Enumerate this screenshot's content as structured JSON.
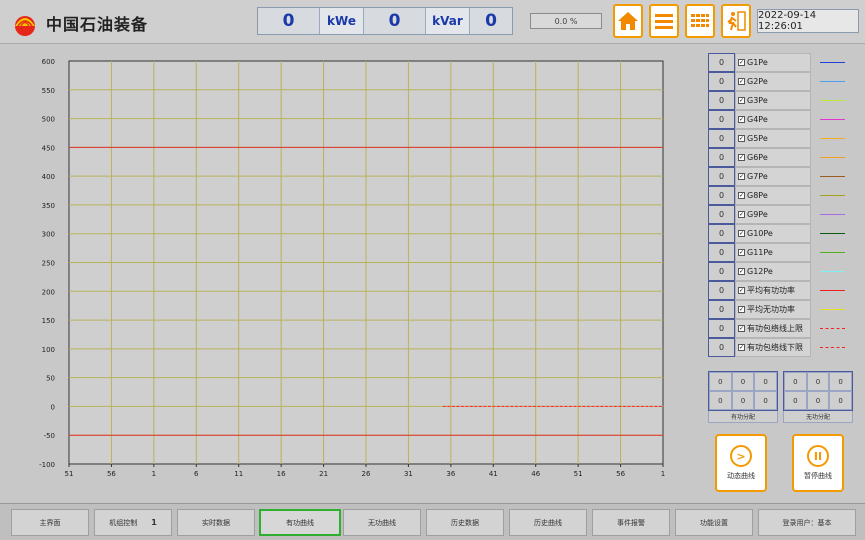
{
  "header": {
    "brand": "中国石油装备",
    "active_power_value": "0",
    "active_power_unit": "kWe",
    "reactive_power_value": "0",
    "reactive_power_unit": "kVar",
    "third_value": "0",
    "percent": "0.0 %",
    "datetime": "2022-09-14 12:26:01",
    "nav_icons": [
      "home-icon",
      "menu-icon",
      "grid-icon",
      "exit-icon"
    ]
  },
  "chart_data": {
    "type": "line",
    "y_ticks": [
      "600",
      "550",
      "500",
      "450",
      "400",
      "350",
      "300",
      "250",
      "200",
      "150",
      "100",
      "50",
      "0",
      "-50",
      "-100"
    ],
    "x_ticks": [
      "51",
      "56",
      "1",
      "6",
      "11",
      "16",
      "21",
      "26",
      "31",
      "36",
      "41",
      "46",
      "51",
      "56",
      "1"
    ],
    "ylim": [
      -100,
      600
    ],
    "grid": true,
    "upper_limit": 450,
    "lower_limit": -50,
    "series": [
      {
        "x_start_tick": 9,
        "x_end_tick": 14,
        "y": 0,
        "color": "#ff3030",
        "dashed": true
      }
    ],
    "colors": {
      "grid": "#b8b35a",
      "limit": "#e03030",
      "axis": "#333333"
    }
  },
  "legend": [
    {
      "value": "0",
      "label": "G1Pe",
      "color": "#1f3fd6",
      "dashed": false
    },
    {
      "value": "0",
      "label": "G2Pe",
      "color": "#4aa0f0",
      "dashed": false
    },
    {
      "value": "0",
      "label": "G3Pe",
      "color": "#b6ef3c",
      "dashed": false
    },
    {
      "value": "0",
      "label": "G4Pe",
      "color": "#e434d4",
      "dashed": false
    },
    {
      "value": "0",
      "label": "G5Pe",
      "color": "#f2b020",
      "dashed": false
    },
    {
      "value": "0",
      "label": "G6Pe",
      "color": "#f0a020",
      "dashed": false
    },
    {
      "value": "0",
      "label": "G7Pe",
      "color": "#9a5a20",
      "dashed": false
    },
    {
      "value": "0",
      "label": "G8Pe",
      "color": "#a79e20",
      "dashed": false
    },
    {
      "value": "0",
      "label": "G9Pe",
      "color": "#a46de0",
      "dashed": false
    },
    {
      "value": "0",
      "label": "G10Pe",
      "color": "#0b5a10",
      "dashed": false
    },
    {
      "value": "0",
      "label": "G11Pe",
      "color": "#54b020",
      "dashed": false
    },
    {
      "value": "0",
      "label": "G12Pe",
      "color": "#7ef0f0",
      "dashed": false
    },
    {
      "value": "0",
      "label": "平均有功功率",
      "color": "#ee2020",
      "dashed": false
    },
    {
      "value": "0",
      "label": "平均无功功率",
      "color": "#e8e020",
      "dashed": false
    },
    {
      "value": "0",
      "label": "有功包络线上限",
      "color": "#ee2020",
      "dashed": true
    },
    {
      "value": "0",
      "label": "有功包络线下限",
      "color": "#ee2020",
      "dashed": true
    }
  ],
  "distribution": {
    "active": {
      "cells": [
        "0",
        "0",
        "0",
        "0",
        "0",
        "0"
      ],
      "label": "有功分配"
    },
    "reactive": {
      "cells": [
        "0",
        "0",
        "0",
        "0",
        "0",
        "0"
      ],
      "label": "无功分配"
    }
  },
  "actions": {
    "dynamic": "动态曲线",
    "pause": "暂停曲线"
  },
  "bottom_nav": {
    "main": "主界面",
    "unit_control": "机组控制",
    "unit_number": "1",
    "realtime": "实时数据",
    "active_curve": "有功曲线",
    "reactive_curve": "无功曲线",
    "history_data": "历史数据",
    "history_curve": "历史曲线",
    "event_alarm": "事件报警",
    "energy": "功能设置",
    "login": "登录用户：基本"
  }
}
